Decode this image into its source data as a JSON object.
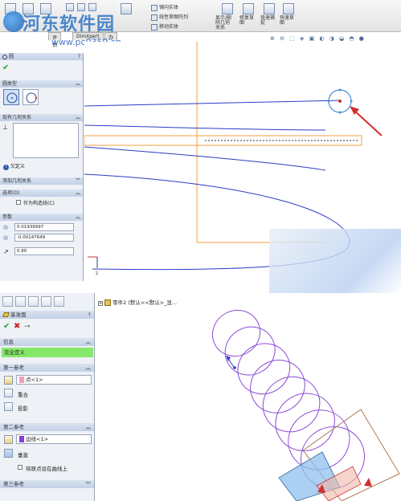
{
  "ribbon": {
    "items_left": [
      "草图",
      "智能尺寸",
      "退出草图"
    ],
    "items_mid": [
      "镜向实体",
      "线性草图阵列",
      "移动实体"
    ],
    "items_right": [
      "显示/删除几何关系",
      "修复草图",
      "快速捕捉",
      "快速草图"
    ],
    "tabs": [
      "评估",
      "DimXpert",
      "办公室产品"
    ]
  },
  "watermark": {
    "line1": "河东软件园",
    "line2": "www.pc0359.cn"
  },
  "top_panel": {
    "title": "圆",
    "help": "?",
    "section_type": "圆类型",
    "section_relations": "现有几何关系",
    "status_text": "欠定义",
    "section_add_relations": "添加几何关系",
    "section_options": "选项(O)",
    "option_construction": "作为构造线(C)",
    "section_params": "参数",
    "param_x": "0.01939997",
    "param_y": "-0.00147649",
    "param_r": "0.80"
  },
  "bottom_panel": {
    "title": "基准面",
    "help": "?",
    "section_info": "信息",
    "info_status": "完全定义",
    "section_ref1": "第一参考",
    "ref1_value": "点<1>",
    "ref1_opt1": "重合",
    "ref1_opt2": "投影",
    "section_ref2": "第二参考",
    "ref2_value": "边线<1>",
    "ref2_opt1": "垂直",
    "ref2_opt2": "将原点设在曲线上",
    "section_ref3": "第三参考",
    "tree_text": "零件2 (默认<<默认>_显..."
  },
  "colors": {
    "accent": "#4a90d9",
    "sketch_orange": "#f0a040",
    "curve_blue": "#2b3cc4",
    "helix_purple": "#8a4bd6",
    "arrow_red": "#d03030",
    "status_green": "#86e86a"
  },
  "icons": [
    "check-icon",
    "close-icon",
    "pin-icon",
    "circle-icon",
    "perimeter-circle-icon",
    "point-icon",
    "edge-icon",
    "coincident-icon",
    "projection-icon",
    "perpendicular-icon",
    "arrow-icon"
  ]
}
